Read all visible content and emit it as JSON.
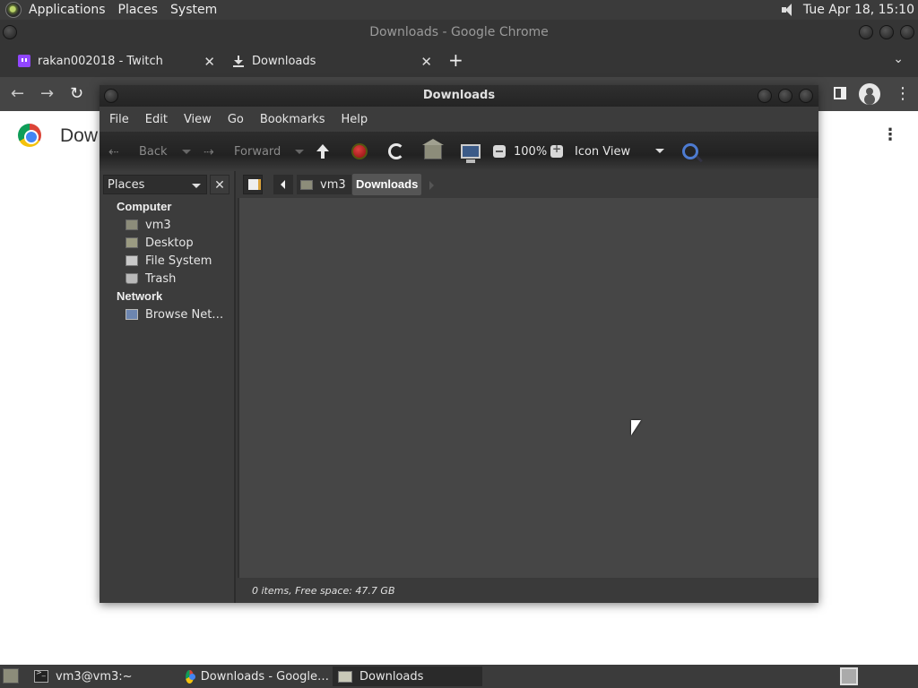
{
  "top_panel": {
    "menus": [
      "Applications",
      "Places",
      "System"
    ],
    "clock": "Tue Apr 18, 15:10"
  },
  "chrome": {
    "window_title": "Downloads - Google Chrome",
    "tabs": [
      {
        "label": "rakan002018 - Twitch"
      },
      {
        "label": "Downloads"
      }
    ],
    "page_heading": "Dow"
  },
  "file_manager": {
    "title": "Downloads",
    "menu": [
      "File",
      "Edit",
      "View",
      "Go",
      "Bookmarks",
      "Help"
    ],
    "toolbar": {
      "back": "Back",
      "forward": "Forward",
      "zoom": "100%",
      "view_mode": "Icon View"
    },
    "sidepane": {
      "selector": "Places",
      "sections": [
        {
          "header": "Computer",
          "items": [
            "vm3",
            "Desktop",
            "File System",
            "Trash"
          ]
        },
        {
          "header": "Network",
          "items": [
            "Browse Net…"
          ]
        }
      ]
    },
    "path": {
      "parent": "vm3",
      "current": "Downloads"
    },
    "status": "0 items, Free space: 47.7 GB"
  },
  "taskbar": {
    "tasks": [
      {
        "label": "vm3@vm3:~"
      },
      {
        "label": "Downloads - Google…"
      },
      {
        "label": "Downloads"
      }
    ]
  }
}
